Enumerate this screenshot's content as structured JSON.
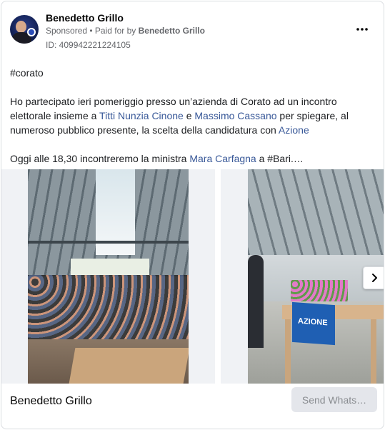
{
  "post": {
    "author": "Benedetto Grillo",
    "sponsored_label": "Sponsored",
    "separator": " • ",
    "paid_for_by_prefix": "Paid for by ",
    "paid_for_by_name": "Benedetto Grillo",
    "ad_id": "ID: 409942221224105",
    "more_icon": "more-horizontal-icon",
    "text": {
      "hashtag": "#corato",
      "p1_a": "Ho partecipato ieri pomeriggio presso un’azienda di Corato ad un incontro elettorale insieme a ",
      "link_1": "Titti Nunzia Cinone",
      "p1_b": " e ",
      "link_2": "Massimo Cassano",
      "p1_c": " per spiegare, al numeroso pubblico presente, la scelta della candidatura con ",
      "link_3": "Azione",
      "p2_a": "Oggi alle 18,30 incontreremo la ministra ",
      "link_4": "Mara Carfagna",
      "p2_b": " a #Bari.…"
    }
  },
  "carousel": {
    "slide2_banner_text": "AZIONE",
    "next_icon": "chevron-right-icon"
  },
  "footer": {
    "name": "Benedetto Grillo",
    "cta_label": "Send Whats…"
  },
  "colors": {
    "link": "#385898",
    "cta_bg": "#e4e6eb",
    "cta_text": "#8a8d91"
  }
}
